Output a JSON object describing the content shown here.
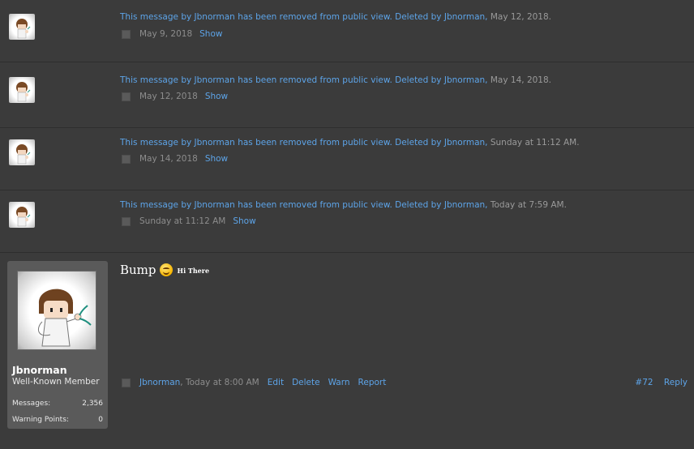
{
  "deleted_posts": [
    {
      "message_prefix": "This message by",
      "author": "Jbnorman",
      "message_suffix": "has been removed from public view.",
      "deleted_by_label": "Deleted by",
      "deleted_by": "Jbnorman",
      "deleted_at": "May 12, 2018",
      "posted_at": "May 9, 2018",
      "show_label": "Show"
    },
    {
      "message_prefix": "This message by",
      "author": "Jbnorman",
      "message_suffix": "has been removed from public view.",
      "deleted_by_label": "Deleted by",
      "deleted_by": "Jbnorman",
      "deleted_at": "May 14, 2018",
      "posted_at": "May 12, 2018",
      "show_label": "Show"
    },
    {
      "message_prefix": "This message by",
      "author": "Jbnorman",
      "message_suffix": "has been removed from public view.",
      "deleted_by_label": "Deleted by",
      "deleted_by": "Jbnorman",
      "deleted_at": "Sunday at 11:12 AM",
      "posted_at": "May 14, 2018",
      "show_label": "Show"
    },
    {
      "message_prefix": "This message by",
      "author": "Jbnorman",
      "message_suffix": "has been removed from public view.",
      "deleted_by_label": "Deleted by",
      "deleted_by": "Jbnorman",
      "deleted_at": "Today at 7:59 AM",
      "posted_at": "Sunday at 11:12 AM",
      "show_label": "Show"
    }
  ],
  "post": {
    "user": {
      "name": "Jbnorman",
      "title": "Well-Known Member",
      "messages_label": "Messages:",
      "messages_value": "2,356",
      "warning_label": "Warning Points:",
      "warning_value": "0"
    },
    "body_text": "Bump",
    "small_text": "Hi There",
    "author": "Jbnorman",
    "timestamp": "Today at 8:00 AM",
    "actions": [
      "Edit",
      "Delete",
      "Warn",
      "Report"
    ],
    "post_number": "#72",
    "reply_label": "Reply"
  },
  "colors": {
    "background": "#3b3b3b",
    "link": "#5da4e8",
    "muted_text": "#8d8d8d",
    "card": "#5a5a5a"
  },
  "icons": {
    "avatar": "avatar-icon",
    "smiley": "smiley-icon",
    "checkbox": "checkbox-icon"
  }
}
